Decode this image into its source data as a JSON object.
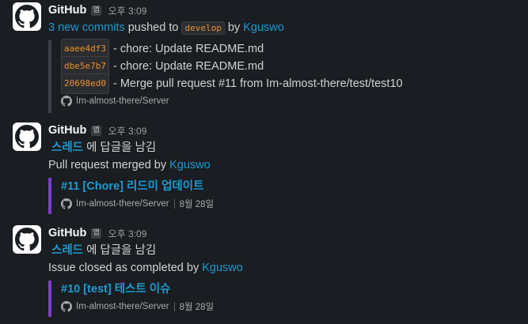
{
  "messages": [
    {
      "sender": "GitHub",
      "app_badge": "앱",
      "time": "오후 3:09",
      "summary": {
        "commits_link": "3 new commits",
        "pushed_to": "pushed to",
        "branch": "develop",
        "by": "by",
        "author": "Kguswo"
      },
      "commits": [
        {
          "hash": "aaee4df3",
          "message": "- chore: Update README.md"
        },
        {
          "hash": "dbe5e7b7",
          "message": "- chore: Update README.md"
        },
        {
          "hash": "20698ed0",
          "message": "- Merge pull request #11 from Im-almost-there/test/test10"
        }
      ],
      "repo": "Im-almost-there/Server"
    },
    {
      "sender": "GitHub",
      "app_badge": "앱",
      "time": "오후 3:09",
      "thread_link": "스레드",
      "thread_text": "에 답글을 남김",
      "event_text": "Pull request merged by",
      "event_author": "Kguswo",
      "attachment_title": "#11 [Chore] 리드미 업데이트",
      "repo": "Im-almost-there/Server",
      "date": "8월 28일"
    },
    {
      "sender": "GitHub",
      "app_badge": "앱",
      "time": "오후 3:09",
      "thread_link": "스레드",
      "thread_text": "에 답글을 남김",
      "event_text": "Issue closed as completed by",
      "event_author": "Kguswo",
      "attachment_title": "#10 [test] 테스트 이슈",
      "repo": "Im-almost-there/Server",
      "date": "8월 28일"
    }
  ],
  "colors": {
    "background": "#1a1d21",
    "link": "#1d9bd1",
    "code_text": "#e8912d",
    "attachment_bar_purple": "#7d3fc9",
    "attachment_bar_grey": "#3e4045"
  }
}
